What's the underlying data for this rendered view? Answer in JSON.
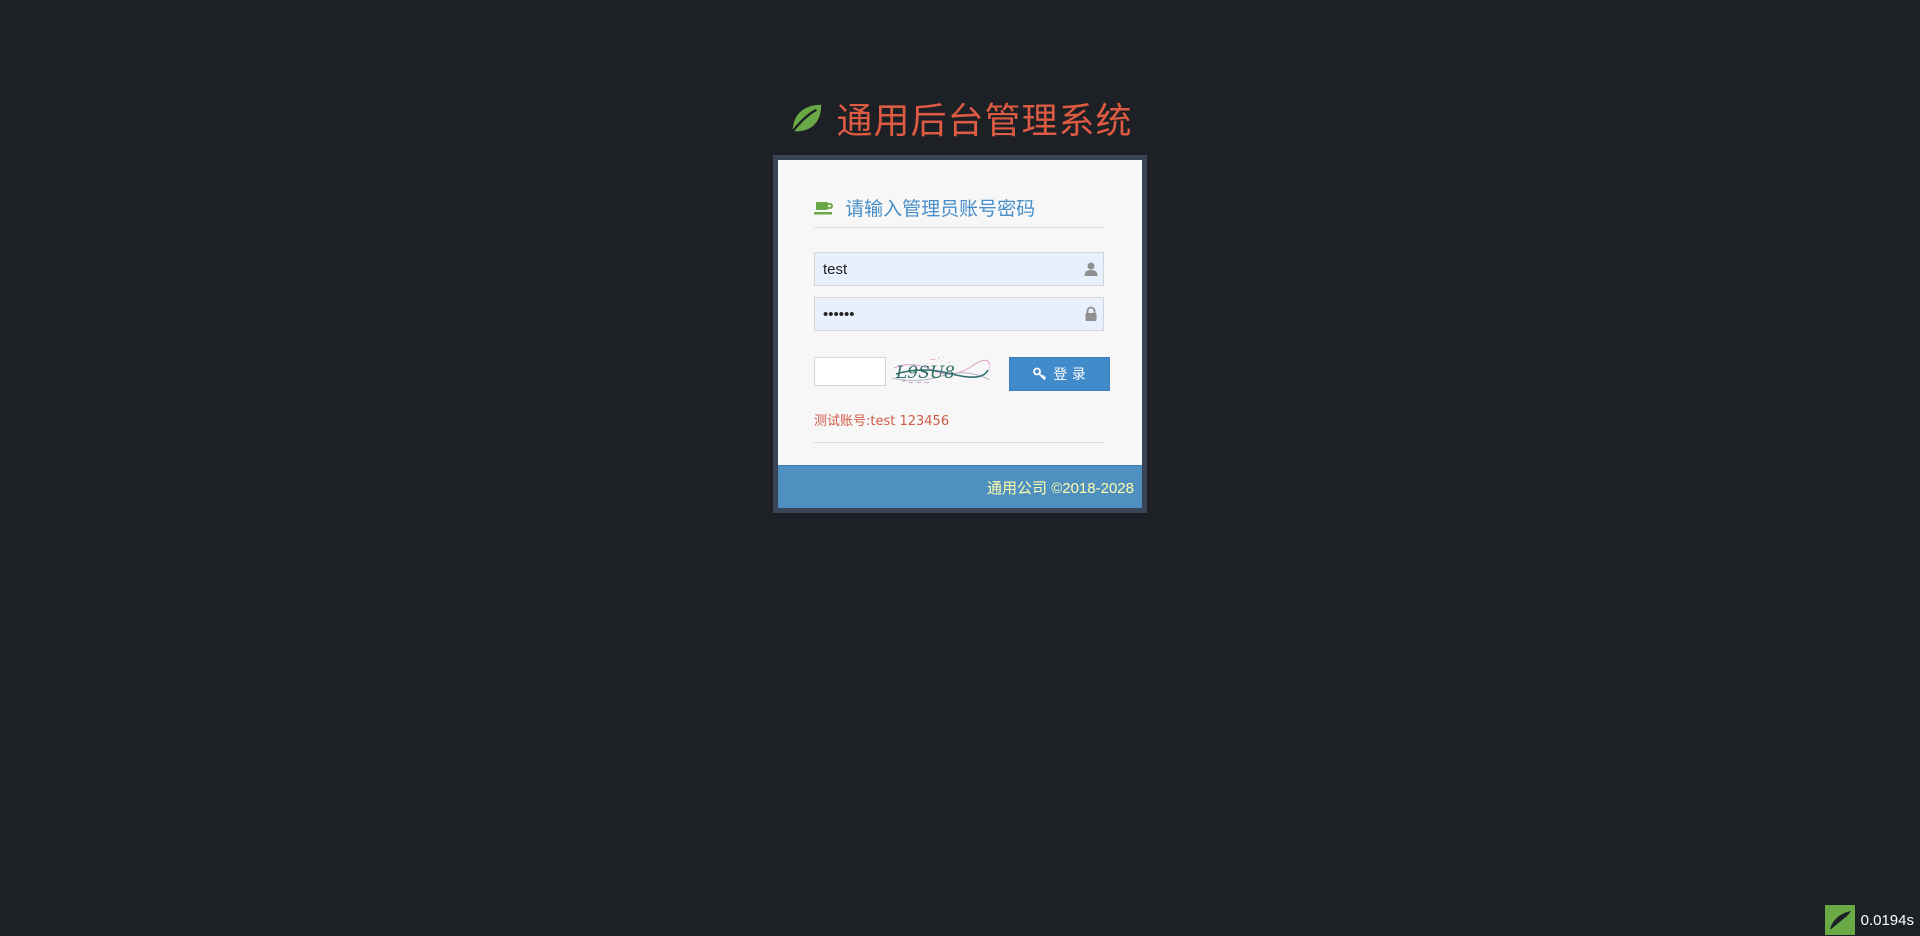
{
  "app": {
    "title": "通用后台管理系统"
  },
  "login": {
    "header": "请输入管理员账号密码",
    "username": {
      "value": "test",
      "icon": "user-icon"
    },
    "password": {
      "value": "123456",
      "icon": "lock-icon"
    },
    "captcha": {
      "value": "",
      "image_text": "L9SU8"
    },
    "submit_label": "登 录",
    "hint": "测试账号:test 123456"
  },
  "footer": {
    "text": "通用公司 ©2018-2028"
  },
  "timer": {
    "text": "0.0194s"
  },
  "colors": {
    "background": "#1d2024",
    "title": "#dd5a43",
    "leaf": "#69aa46",
    "header_text": "#478fca",
    "button": "#428bca",
    "footer_bg": "#5090c1",
    "footer_text": "#feffa9",
    "hint": "#d15b47"
  }
}
